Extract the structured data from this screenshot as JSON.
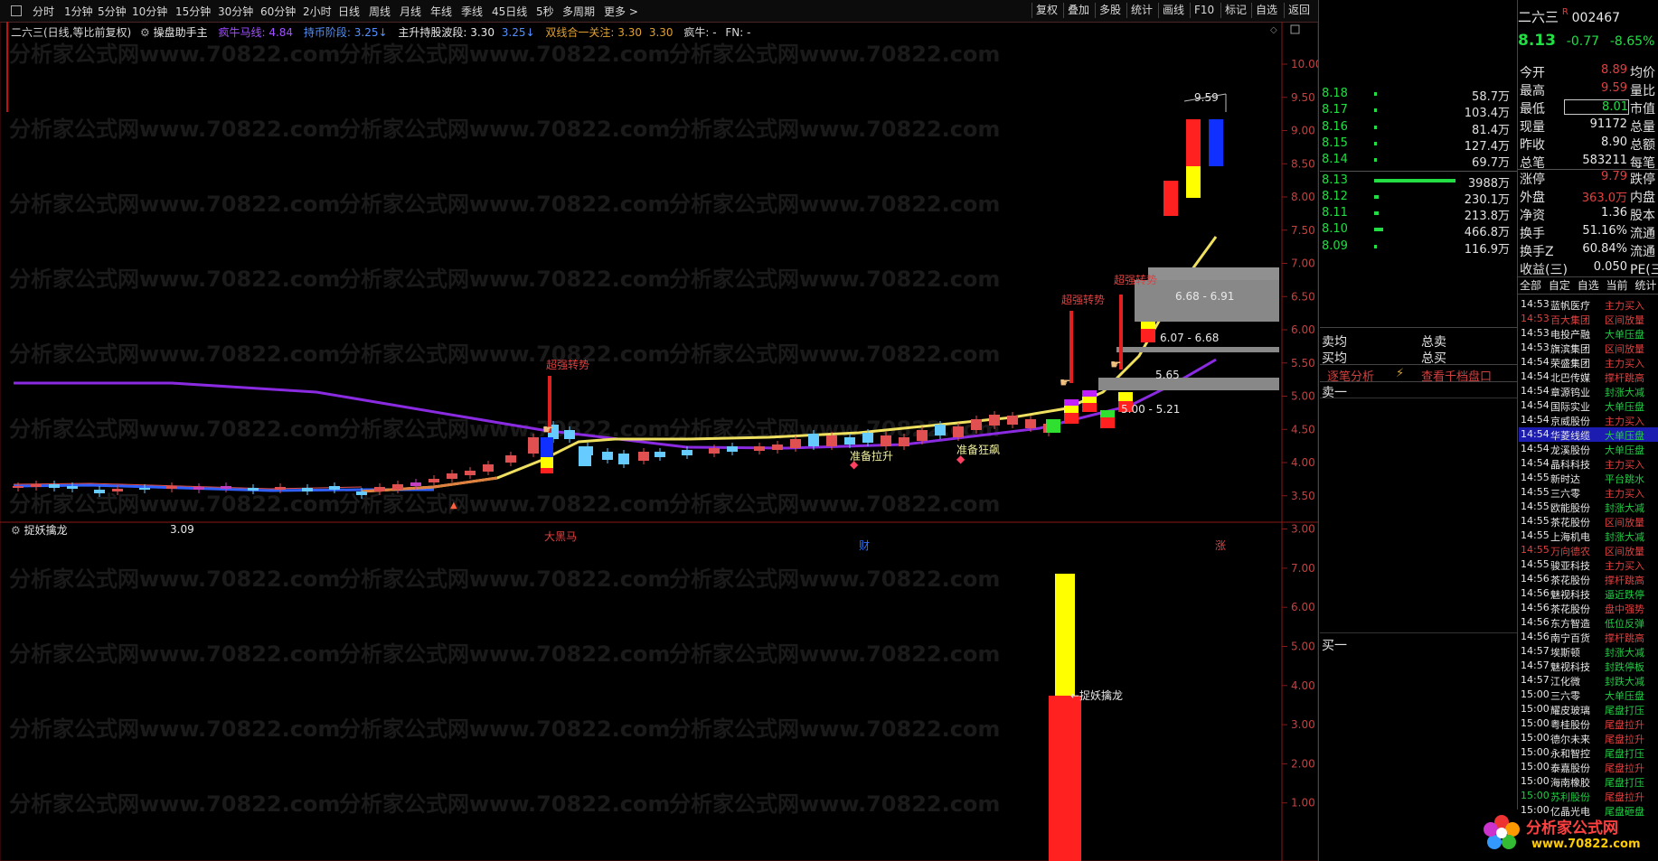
{
  "toolbar": {
    "periods": [
      "分时",
      "1分钟",
      "5分钟",
      "10分钟",
      "15分钟",
      "30分钟",
      "60分钟",
      "2小时",
      "日线",
      "周线",
      "月线",
      "年线",
      "季线",
      "45日线",
      "5秒",
      "多周期",
      "更多 >"
    ],
    "right_buttons": [
      "复权",
      "叠加",
      "多股",
      "统计",
      "画线",
      "F10",
      "标记",
      "自选",
      "返回"
    ]
  },
  "header": {
    "stock_title": "二六三(日线,等比前复权)",
    "indicator_name": "操盘助手主",
    "crazy_horse_label": "疯牛马线:",
    "crazy_horse_value": "4.84",
    "hold_stage_label": "持币阶段:",
    "hold_stage_value": "3.25",
    "main_up_label": "主升持股波段:",
    "main_up_value1": "3.30",
    "main_up_value2": "3.25",
    "dual_line_label": "双线合一关注:",
    "dual_line_value1": "3.30",
    "dual_line_value2": "3.30",
    "crazy_cow": "疯牛: -",
    "fn": "FN: -"
  },
  "main_chart": {
    "y_axis_labels": [
      "10.00",
      "9.50",
      "9.00",
      "8.50",
      "8.00",
      "7.50",
      "7.00",
      "6.50",
      "6.00",
      "5.50",
      "5.00",
      "4.50",
      "4.00",
      "3.50",
      "3.00"
    ],
    "annotations": {
      "super_strong_1": "超强转势",
      "super_strong_2": "超强转势",
      "super_strong_3": "超强转势",
      "big_black_horse": "大黑马",
      "zone_high": "6.68 - 6.91",
      "zone_mid": "6.07 - 6.68",
      "zone_low": "5.00 - 5.21",
      "zone_small": "5.65",
      "price_high": "9.59",
      "price_low": "3.09",
      "ready_rise": "准备拉升",
      "ready_crazy": "准备狂飙",
      "cai": "财",
      "zhang": "涨"
    }
  },
  "sub_chart": {
    "title": "捉妖擒龙",
    "y_axis_labels": [
      "7.00",
      "6.00",
      "5.00",
      "4.00",
      "3.00",
      "2.00",
      "1.00"
    ],
    "bar_label": "←捉妖擒龙"
  },
  "quote": {
    "name": "二六三",
    "badge": "R",
    "code": "002467",
    "price": "8.13",
    "change": "-0.77",
    "change_pct": "-8.65%",
    "fields_left": [
      {
        "label": "今开",
        "value": "8.89",
        "label2": "均价"
      },
      {
        "label": "最高",
        "value": "9.59",
        "label2": "量比"
      },
      {
        "label": "最低",
        "value": "8.01",
        "label2": "市值"
      },
      {
        "label": "现量",
        "value": "91172",
        "label2": "总量"
      },
      {
        "label": "昨收",
        "value": "8.90",
        "label2": "总额"
      },
      {
        "label": "总笔",
        "value": "583211",
        "label2": "每笔"
      }
    ],
    "order_book": [
      {
        "price": "8.18",
        "vol": "58.7万"
      },
      {
        "price": "8.17",
        "vol": "103.4万"
      },
      {
        "price": "8.16",
        "vol": "81.4万"
      },
      {
        "price": "8.15",
        "vol": "127.4万"
      },
      {
        "price": "8.14",
        "vol": "69.7万"
      },
      {
        "price": "8.13",
        "vol": "3988万"
      },
      {
        "price": "8.12",
        "vol": "230.1万"
      },
      {
        "price": "8.11",
        "vol": "213.8万"
      },
      {
        "price": "8.10",
        "vol": "466.8万"
      },
      {
        "price": "8.09",
        "vol": "116.9万"
      }
    ],
    "stats": [
      {
        "label": "涨停",
        "value": "9.79",
        "label2": "跌停"
      },
      {
        "label": "外盘",
        "value": "363.0万",
        "label2": "内盘"
      },
      {
        "label": "净资",
        "value": "1.36",
        "label2": "股本"
      },
      {
        "label": "换手",
        "value": "51.16%",
        "label2": "流通"
      },
      {
        "label": "换手Z",
        "value": "60.84%",
        "label2": "流通"
      },
      {
        "label": "收益(三)",
        "value": "0.050",
        "label2": "PE(三"
      }
    ]
  },
  "tabs": [
    "全部",
    "自定",
    "自选",
    "当前",
    "统计"
  ],
  "order_panel": {
    "sell_avg": "卖均",
    "buy_avg": "买均",
    "total_sell": "总卖",
    "total_buy": "总买",
    "tick_analysis": "逐笔分析",
    "view_levels": "查看千档盘口",
    "sell_one": "卖一",
    "buy_one": "买一"
  },
  "events": [
    {
      "time": "14:53",
      "name": "蓝帆医疗",
      "type": "主力买入"
    },
    {
      "time": "14:53",
      "name": "百大集团",
      "type": "区间放量"
    },
    {
      "time": "14:53",
      "name": "电投产融",
      "type": "大单压盘"
    },
    {
      "time": "14:53",
      "name": "旗滨集团",
      "type": "区间放量"
    },
    {
      "time": "14:54",
      "name": "荣盛集团",
      "type": "主力买入"
    },
    {
      "time": "14:54",
      "name": "北巴传媒",
      "type": "撑杆跳高"
    },
    {
      "time": "14:54",
      "name": "章源钨业",
      "type": "封涨大减"
    },
    {
      "time": "14:54",
      "name": "国际实业",
      "type": "大单压盘"
    },
    {
      "time": "14:54",
      "name": "京威股份",
      "type": "主力买入"
    },
    {
      "time": "14:54",
      "name": "华菱线缆",
      "type": "大单压盘"
    },
    {
      "time": "14:54",
      "name": "龙溪股份",
      "type": "大单压盘"
    },
    {
      "time": "14:54",
      "name": "晶科科技",
      "type": "主力买入"
    },
    {
      "time": "14:55",
      "name": "新时达",
      "type": "平台跳水"
    },
    {
      "time": "14:55",
      "name": "三六零",
      "type": "主力买入"
    },
    {
      "time": "14:55",
      "name": "欧能股份",
      "type": "封涨大减"
    },
    {
      "time": "14:55",
      "name": "茶花股份",
      "type": "区间放量"
    },
    {
      "time": "14:55",
      "name": "上海机电",
      "type": "封涨大减"
    },
    {
      "time": "14:55",
      "name": "万向德农",
      "type": "区间放量"
    },
    {
      "time": "14:55",
      "name": "骏亚科技",
      "type": "主力买入"
    },
    {
      "time": "14:56",
      "name": "茶花股份",
      "type": "撑杆跳高"
    },
    {
      "time": "14:56",
      "name": "魅视科技",
      "type": "逼近跌停"
    },
    {
      "time": "14:56",
      "name": "茶花股份",
      "type": "盘中强势"
    },
    {
      "time": "14:56",
      "name": "东方智造",
      "type": "低位反弹"
    },
    {
      "time": "14:56",
      "name": "南宁百货",
      "type": "撑杆跳高"
    },
    {
      "time": "14:57",
      "name": "埃斯顿",
      "type": "封涨大减"
    },
    {
      "time": "14:57",
      "name": "魅视科技",
      "type": "封跌停板"
    },
    {
      "time": "14:57",
      "name": "江化微",
      "type": "封跌大减"
    },
    {
      "time": "15:00",
      "name": "三六零",
      "type": "大单压盘"
    },
    {
      "time": "15:00",
      "name": "耀皮玻璃",
      "type": "尾盘打压"
    },
    {
      "time": "15:00",
      "name": "粤桂股份",
      "type": "尾盘拉升"
    },
    {
      "time": "15:00",
      "name": "德尔未来",
      "type": "尾盘拉升"
    },
    {
      "time": "15:00",
      "name": "永和智控",
      "type": "尾盘打压"
    },
    {
      "time": "15:00",
      "name": "泰嘉股份",
      "type": "尾盘拉升"
    },
    {
      "time": "15:00",
      "name": "海南橡胶",
      "type": "尾盘打压"
    },
    {
      "time": "15:00",
      "name": "苏利股份",
      "type": "尾盘拉升"
    },
    {
      "time": "15:00",
      "name": "亿晶光电",
      "type": "尾盘砸盘"
    }
  ],
  "watermark": {
    "text": "分析家公式网www.70822.com"
  },
  "logo": {
    "line1": "分析家公式网",
    "line2": "www.70822.com"
  }
}
